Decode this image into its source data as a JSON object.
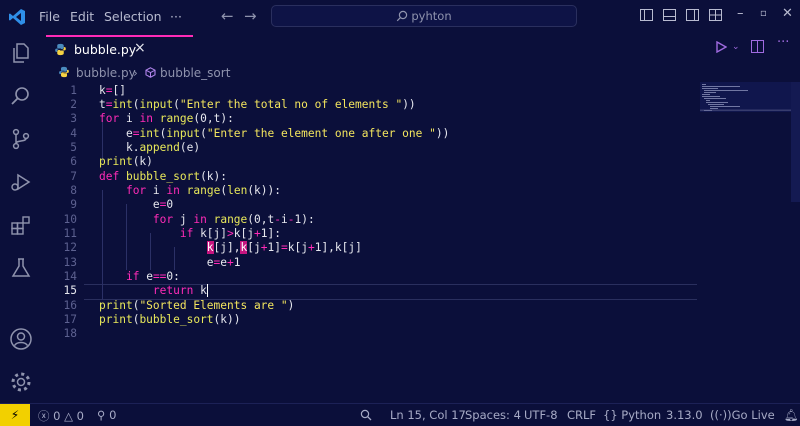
{
  "titlebar": {
    "menu": [
      "File",
      "Edit",
      "Selection",
      "···"
    ],
    "search_text": "pyhton"
  },
  "tab": {
    "label": "bubble.py",
    "close": "×"
  },
  "breadcrumb": {
    "file": "bubble.py",
    "separator": "›",
    "symbol": "bubble_sort"
  },
  "editor": {
    "line_numbers": [
      "1",
      "2",
      "3",
      "4",
      "5",
      "6",
      "7",
      "8",
      "9",
      "10",
      "11",
      "12",
      "13",
      "14",
      "15",
      "16",
      "17",
      "18"
    ],
    "active_line": "15"
  },
  "statusbar": {
    "remote": "⚡",
    "errors": "0",
    "warnings": "0",
    "ports": "0",
    "cursor": "Ln 15, Col 17",
    "spaces": "Spaces: 4",
    "encoding": "UTF-8",
    "eol": "CRLF",
    "language": "Python",
    "python_version": "3.13.0",
    "golive": "Go Live"
  },
  "colors": {
    "accent": "#ff2bb7",
    "background": "#0b0f3a",
    "status_remote": "#f2d000"
  }
}
